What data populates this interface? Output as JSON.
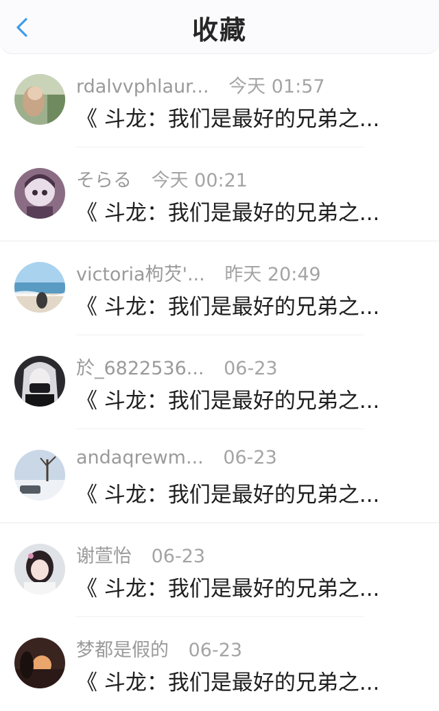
{
  "header": {
    "title": "收藏",
    "back_icon": "chevron-left-icon",
    "accent_color": "#3d9be9"
  },
  "items": [
    {
      "name": "rdalvvphlaur...",
      "time": "今天 01:57",
      "content": "《 斗龙：我们是最好的兄弟之...",
      "avatar": "avatar-photo-icon"
    },
    {
      "name": "そらる",
      "time": "今天 00:21",
      "content": "《 斗龙：我们是最好的兄弟之...",
      "avatar": "avatar-anime-icon"
    },
    {
      "name": "victoria枸芡'...",
      "time": "昨天 20:49",
      "content": "《 斗龙：我们是最好的兄弟之...",
      "avatar": "avatar-beach-icon"
    },
    {
      "name": "於_6822536...",
      "time": "06-23",
      "content": "《 斗龙：我们是最好的兄弟之...",
      "avatar": "avatar-anime-masked-icon"
    },
    {
      "name": "andaqrewm...",
      "time": "06-23",
      "content": "《 斗龙：我们是最好的兄弟之...",
      "avatar": "avatar-winter-icon"
    },
    {
      "name": "谢萱怡",
      "time": "06-23",
      "content": "《 斗龙：我们是最好的兄弟之...",
      "avatar": "avatar-girl-icon"
    },
    {
      "name": "梦都是假的",
      "time": "06-23",
      "content": "《 斗龙：我们是最好的兄弟之...",
      "avatar": "avatar-sunset-icon"
    }
  ]
}
